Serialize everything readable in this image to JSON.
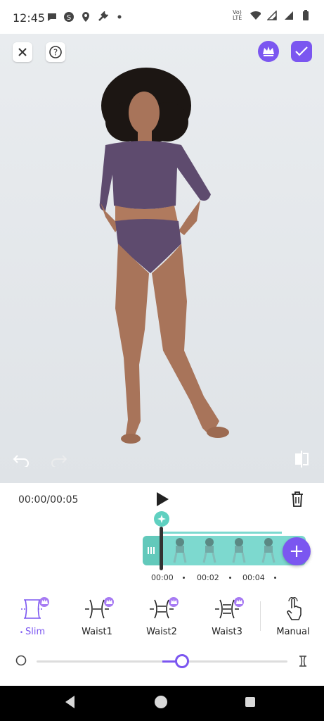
{
  "status_bar": {
    "time": "12:45",
    "network_label": "Vo) LTE",
    "icons": [
      "chat-icon",
      "s-app-icon",
      "location-icon",
      "wrench-icon",
      "dot-icon",
      "wifi-icon",
      "signal-icon",
      "signal-icon",
      "battery-icon"
    ]
  },
  "toolbar": {
    "close_icon": "close-icon",
    "help_icon": "help-icon",
    "premium_icon": "crown-icon",
    "confirm_icon": "check-icon",
    "undo_icon": "undo-icon",
    "redo_icon": "redo-icon",
    "compare_icon": "compare-icon"
  },
  "playback": {
    "time": "00:00/00:05",
    "play_icon": "play-icon",
    "delete_icon": "trash-icon"
  },
  "timeline": {
    "ticks": [
      "00:00",
      "00:02",
      "00:04"
    ],
    "add_label": "+"
  },
  "tools": [
    {
      "label": "Slim",
      "active": true,
      "premium": true
    },
    {
      "label": "Waist1",
      "active": false,
      "premium": true
    },
    {
      "label": "Waist2",
      "active": false,
      "premium": true
    },
    {
      "label": "Waist3",
      "active": false,
      "premium": true
    },
    {
      "label": "Manual",
      "active": false,
      "premium": false
    }
  ],
  "slider": {
    "value": 0.58
  },
  "colors": {
    "accent": "#7b56f0",
    "timeline": "#7dd9cf",
    "preview_bg": "#e6e9ec"
  }
}
